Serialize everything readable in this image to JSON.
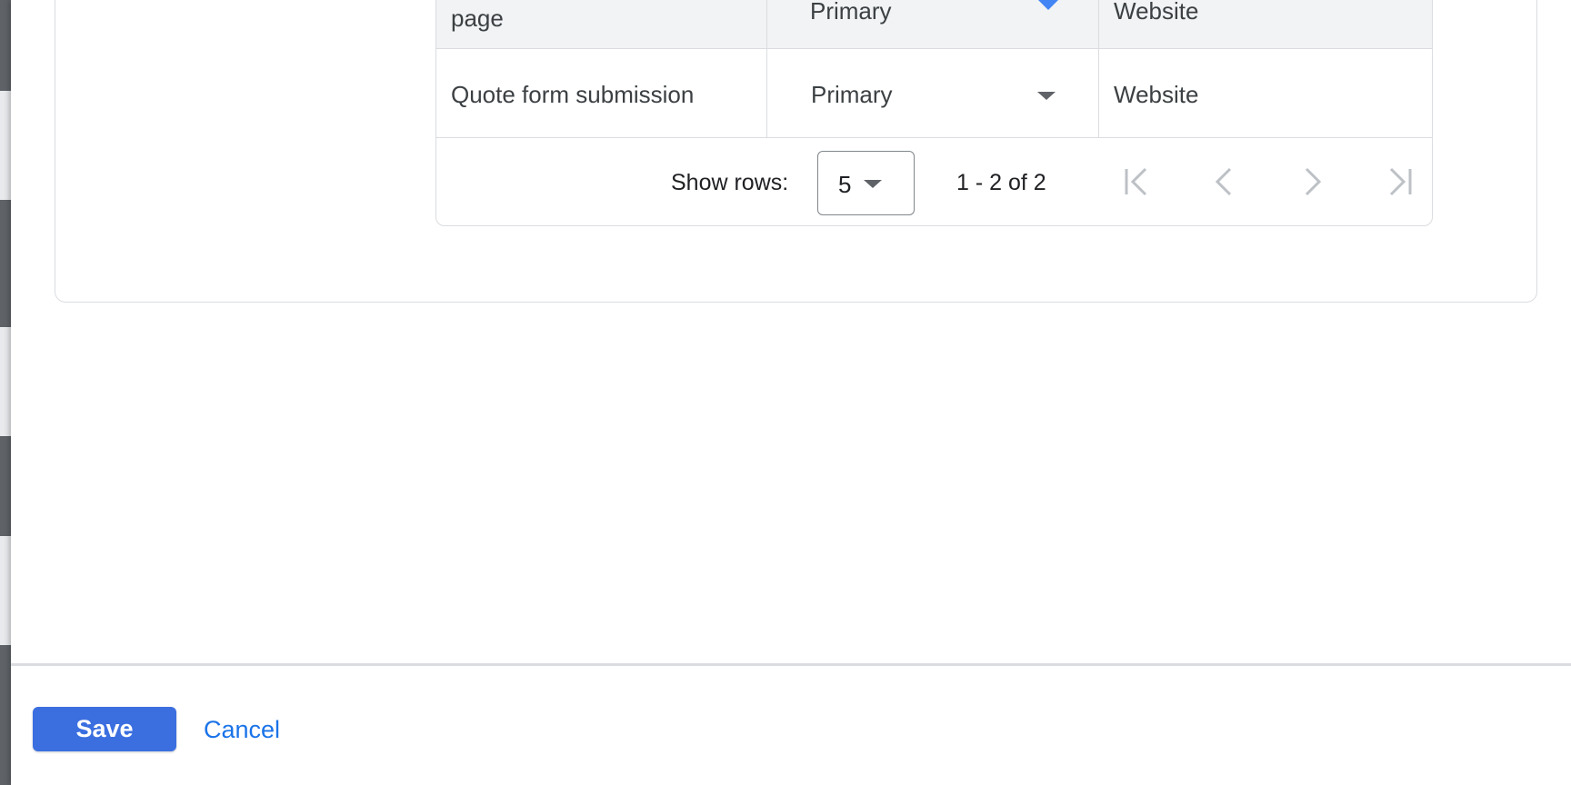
{
  "table": {
    "rows": [
      {
        "conversion_action": "page",
        "optimization": "Primary",
        "source": "Website"
      },
      {
        "conversion_action": "Quote form submission",
        "optimization": "Primary",
        "source": "Website"
      }
    ]
  },
  "pagination": {
    "show_rows_label": "Show rows:",
    "rows_per_page": "5",
    "range_text": "1 - 2 of 2"
  },
  "footer": {
    "save_label": "Save",
    "cancel_label": "Cancel"
  },
  "colors": {
    "accent": "#3b6fe0",
    "link": "#1a73e8",
    "dropdown_active": "#4285f4",
    "border": "#dadce0"
  },
  "icons": {
    "first_page": "first-page-icon",
    "prev_page": "chevron-left-icon",
    "next_page": "chevron-right-icon",
    "last_page": "last-page-icon",
    "dropdown": "caret-down-icon"
  }
}
